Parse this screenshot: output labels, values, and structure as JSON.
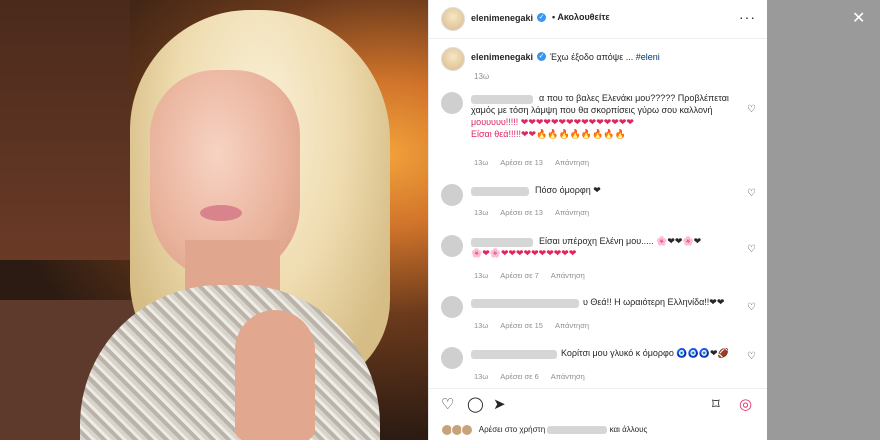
{
  "colors": {
    "accent": "#3897f0",
    "heart": "#e0245e",
    "meta": "#8e8e8e"
  },
  "post": {
    "username": "elenimenegaki",
    "follow_label": "Ακολουθείτε",
    "more_icon": "more-options-icon",
    "caption_text": "Έχω έξοδο απόψε ...",
    "caption_tag": "#eleni",
    "caption_time": "13ω"
  },
  "comments": [
    {
      "line1": "α που το βαλες Ελενάκι μου????? Προβλέπεται",
      "line2": "χαμός με τόση λάμψη που θα σκορπίσεις γύρω σου καλλονή",
      "line3": "μουυυυυ!!!!! ❤❤❤❤❤❤❤❤❤❤❤❤❤❤❤",
      "line4": "Είσαι θεά!!!!!❤❤🔥🔥🔥🔥🔥🔥🔥🔥",
      "time": "13ω",
      "likes": "Αρέσει σε 13",
      "reply": "Απάντηση"
    },
    {
      "line1": "Πόσο όμορφη ❤",
      "time": "13ω",
      "likes": "Αρέσει σε 13",
      "reply": "Απάντηση"
    },
    {
      "line1": "Είσαι υπέροχη Ελένη μου..... 🌸❤❤🌸❤",
      "line2": "🌸❤🌸❤❤❤❤❤❤❤❤❤❤",
      "time": "13ω",
      "likes": "Αρέσει σε 7",
      "reply": "Απάντηση"
    },
    {
      "line1": "υ Θεά!! Η ωραιότερη Ελληνίδα!!❤❤",
      "time": "13ω",
      "likes": "Αρέσει σε 15",
      "reply": "Απάντηση"
    },
    {
      "line1": "Κορίτσι μου γλυκό κ όμορφο 🧿🧿🧿❤🏈",
      "time": "13ω",
      "likes": "Αρέσει σε 6",
      "reply": "Απάντηση"
    }
  ],
  "footer": {
    "likes_prefix": "Αρέσει στο χρήστη",
    "likes_suffix": "και άλλους"
  }
}
